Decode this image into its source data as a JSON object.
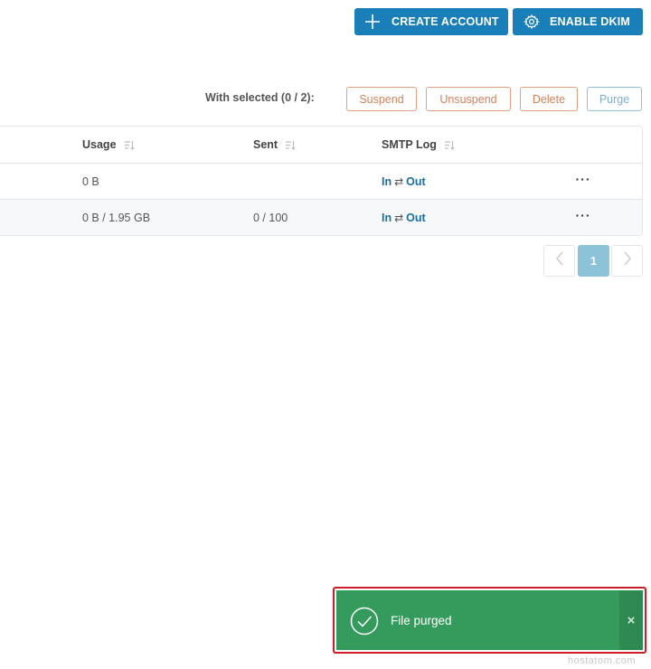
{
  "toolbar": {
    "create_label": "CREATE ACCOUNT",
    "dkim_label": "ENABLE DKIM",
    "accent_color": "#1a7fb8"
  },
  "bulk": {
    "label": "With selected (0 / 2):",
    "suspend": "Suspend",
    "unsuspend": "Unsuspend",
    "delete": "Delete",
    "purge": "Purge"
  },
  "table": {
    "columns": [
      "Usage",
      "Sent",
      "SMTP Log"
    ],
    "rows": [
      {
        "usage": "0 B",
        "sent": "",
        "log_in": "In",
        "log_sep": "⇄",
        "log_out": "Out",
        "more": "···"
      },
      {
        "usage": "0 B / 1.95 GB",
        "sent": "0 / 100",
        "log_in": "In",
        "log_sep": "⇄",
        "log_out": "Out",
        "more": "···"
      }
    ]
  },
  "pagination": {
    "current": "1"
  },
  "toast": {
    "message": "File purged",
    "close": "×",
    "color": "#359b5c"
  },
  "watermark": "hostatom.com",
  "icons": [
    "plus-icon",
    "gear-icon",
    "sort-icon",
    "chevron-left-icon",
    "chevron-right-icon",
    "check-circle-icon",
    "close-icon"
  ]
}
